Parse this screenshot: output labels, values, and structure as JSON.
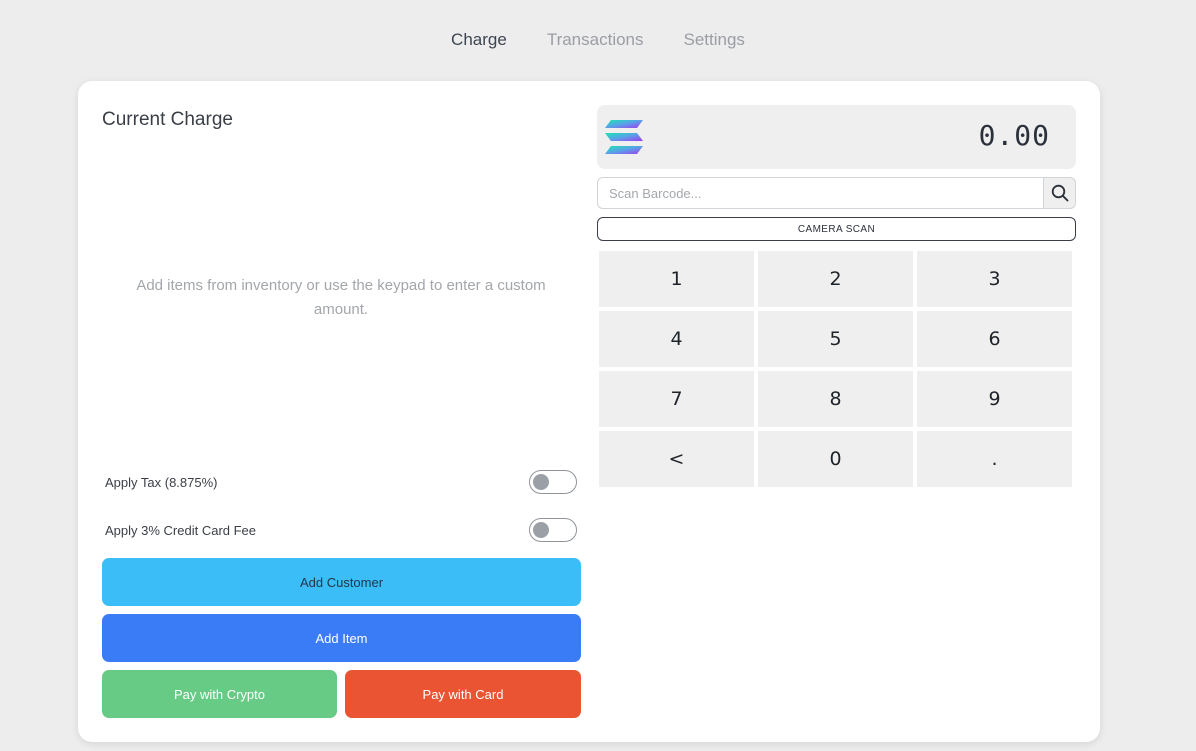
{
  "nav": {
    "tabs": [
      {
        "label": "Charge",
        "active": true
      },
      {
        "label": "Transactions",
        "active": false
      },
      {
        "label": "Settings",
        "active": false
      }
    ]
  },
  "charge": {
    "title": "Current Charge",
    "empty_message": "Add items from inventory or use the keypad to enter a custom amount.",
    "tax_label": "Apply Tax (8.875%)",
    "tax_enabled": false,
    "fee_label": "Apply 3% Credit Card Fee",
    "fee_enabled": false
  },
  "buttons": {
    "add_customer": "Add Customer",
    "add_item": "Add Item",
    "pay_crypto": "Pay with Crypto",
    "pay_card": "Pay with Card"
  },
  "display": {
    "amount": "0.00",
    "icon": "solana-logo-icon"
  },
  "barcode": {
    "placeholder": "Scan Barcode...",
    "value": "",
    "search_icon": "search-icon"
  },
  "camera_scan_label": "CAMERA SCAN",
  "keypad": {
    "keys": [
      "1",
      "2",
      "3",
      "4",
      "5",
      "6",
      "7",
      "8",
      "9",
      "<",
      "0",
      "."
    ]
  },
  "colors": {
    "add_customer": "#3bbdf7",
    "add_item": "#3a7cf6",
    "pay_crypto": "#67cb85",
    "pay_card": "#ea5433"
  }
}
